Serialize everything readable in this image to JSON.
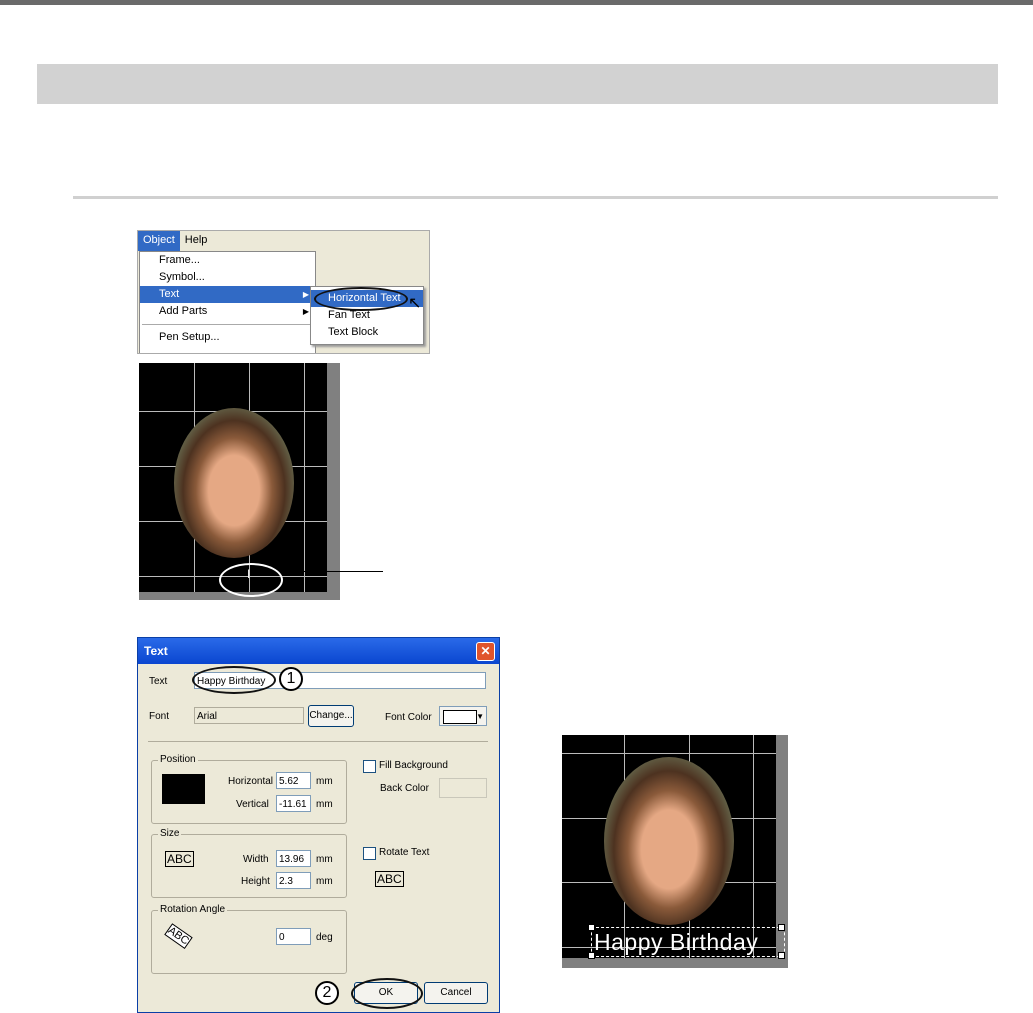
{
  "menu": {
    "bar": [
      "Object",
      "Help"
    ],
    "items": [
      {
        "label": "Frame..."
      },
      {
        "label": "Symbol..."
      },
      {
        "label": "Text",
        "submenu": true
      },
      {
        "label": "Add Parts",
        "submenu": true
      },
      {
        "label": "Pen Setup..."
      }
    ],
    "submenu": [
      "Horizontal Text",
      "Fan Text",
      "Text Block"
    ],
    "toolbar_icons": [
      "undo-icon",
      "redo-icon"
    ]
  },
  "dialog": {
    "title": "Text",
    "text_label": "Text",
    "text_value": "Happy Birthday",
    "font_label": "Font",
    "font_value": "Arial",
    "change_btn": "Change...",
    "font_color_label": "Font Color",
    "position_group": "Position",
    "horizontal_label": "Horizontal",
    "horizontal_value": "5.62",
    "vertical_label": "Vertical",
    "vertical_value": "-11.61",
    "size_group": "Size",
    "width_label": "Width",
    "width_value": "13.96",
    "height_label": "Height",
    "height_value": "2.3",
    "rotation_group": "Rotation Angle",
    "angle_value": "0",
    "deg": "deg",
    "mm": "mm",
    "fill_bg": "Fill Background",
    "back_color": "Back Color",
    "rotate_text": "Rotate Text",
    "abc": "ABC",
    "ok": "OK",
    "cancel": "Cancel"
  },
  "callouts": {
    "one": "1",
    "two": "2"
  },
  "result_text": "Happy Birthday"
}
